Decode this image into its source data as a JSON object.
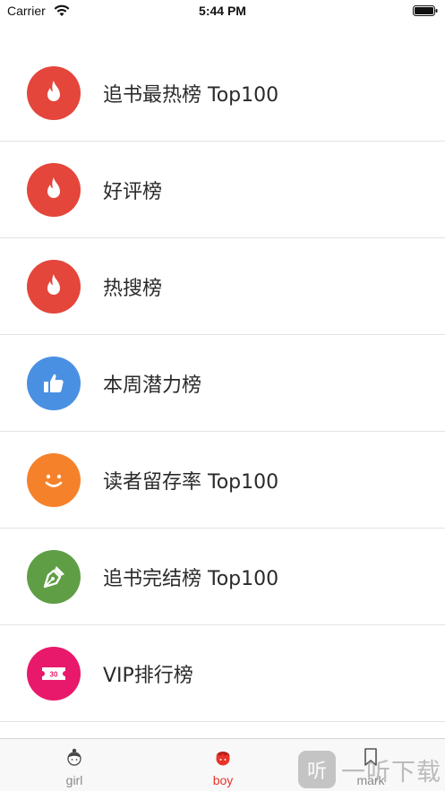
{
  "status_bar": {
    "carrier": "Carrier",
    "time": "5:44 PM"
  },
  "rankings": [
    {
      "label": "追书最热榜 Top100",
      "icon": "flame-icon",
      "color": "#e4463b"
    },
    {
      "label": "好评榜",
      "icon": "flame-icon",
      "color": "#e4463b"
    },
    {
      "label": "热搜榜",
      "icon": "flame-icon",
      "color": "#e4463b"
    },
    {
      "label": "本周潜力榜",
      "icon": "thumbs-up-icon",
      "color": "#4a90e2"
    },
    {
      "label": "读者留存率 Top100",
      "icon": "smiley-icon",
      "color": "#f5822a"
    },
    {
      "label": "追书完结榜 Top100",
      "icon": "pen-nib-icon",
      "color": "#5f9e45"
    },
    {
      "label": "VIP排行榜",
      "icon": "ticket-icon",
      "color": "#e8196a",
      "ticket_text": "30"
    }
  ],
  "tabbar": {
    "tabs": [
      {
        "label": "girl",
        "icon": "girl-avatar-icon",
        "active": false
      },
      {
        "label": "boy",
        "icon": "boy-avatar-icon",
        "active": true
      },
      {
        "label": "mark",
        "icon": "bookmark-icon",
        "active": false
      }
    ],
    "active_color": "#e8342a",
    "inactive_color": "#8a8a8a"
  },
  "watermark": {
    "glyph": "听",
    "text": "一听下载"
  }
}
